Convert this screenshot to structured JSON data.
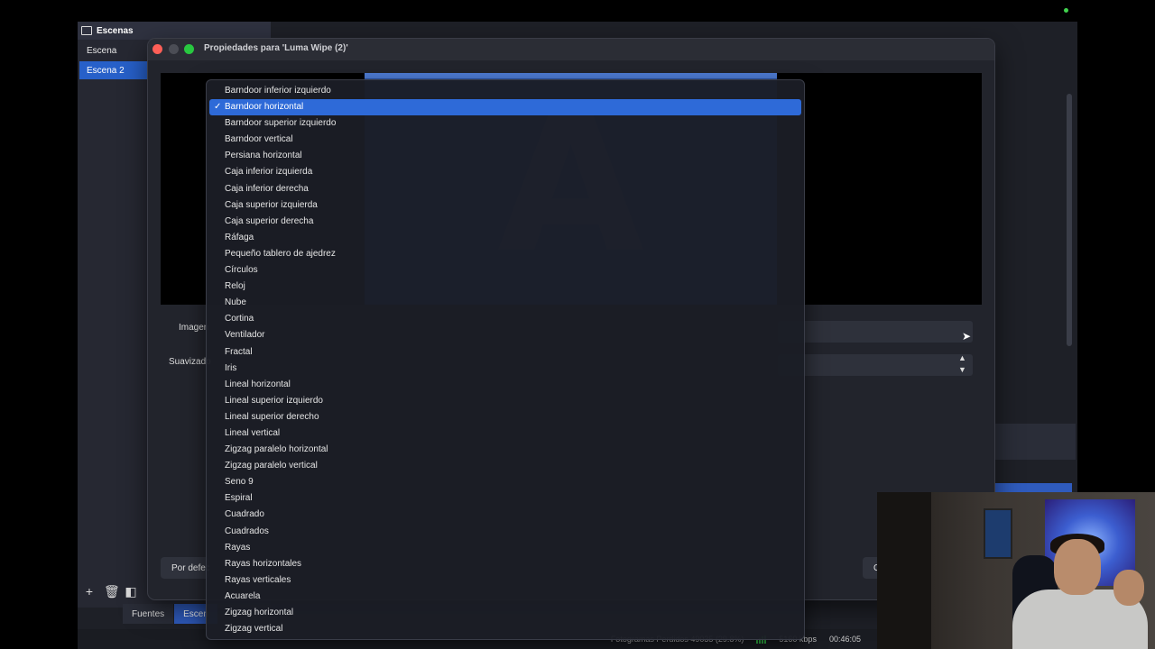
{
  "scenes_panel": {
    "title": "Escenas",
    "items": [
      {
        "label": "Escena",
        "selected": false
      },
      {
        "label": "Escena 2",
        "selected": true
      }
    ],
    "tools": [
      "plus-icon",
      "trash-icon",
      "filter-icon"
    ]
  },
  "bottom_tabs": [
    {
      "label": "Fuentes",
      "active": false
    },
    {
      "label": "Escen",
      "active": true
    }
  ],
  "status_bar": {
    "dropped_frames": "Fotogramas Perdidos 49035 (29.8%)",
    "bitrate": "5160 kbps",
    "time": "00:46:05"
  },
  "dialog": {
    "title": "Propiedades para 'Luma Wipe (2)'",
    "preview_letter": "A",
    "image_label": "Imagen",
    "smoothing_label": "Suavizado",
    "defaults_button": "Por defecto",
    "ok_button": "OK"
  },
  "dropdown": {
    "selected_index": 1,
    "options": [
      "Barndoor inferior izquierdo",
      "Barndoor horizontal",
      "Barndoor superior izquierdo",
      "Barndoor vertical",
      "Persiana horizontal",
      "Caja inferior izquierda",
      "Caja inferior derecha",
      "Caja superior izquierda",
      "Caja superior derecha",
      "Ráfaga",
      "Pequeño tablero de ajedrez",
      "Círculos",
      "Reloj",
      "Nube",
      "Cortina",
      "Ventilador",
      "Fractal",
      "Iris",
      "Lineal horizontal",
      "Lineal superior izquierdo",
      "Lineal superior derecho",
      "Lineal vertical",
      "Zigzag paralelo horizontal",
      "Zigzag paralelo vertical",
      "Seno 9",
      "Espiral",
      "Cuadrado",
      "Cuadrados",
      "Rayas",
      "Rayas horizontales",
      "Rayas verticales",
      "Acuarela",
      "Zigzag horizontal",
      "Zigzag vertical"
    ],
    "check_glyph": "✓"
  },
  "colors": {
    "accent": "#2e6ad8",
    "close": "#ff5f57",
    "maximize": "#28c840"
  }
}
